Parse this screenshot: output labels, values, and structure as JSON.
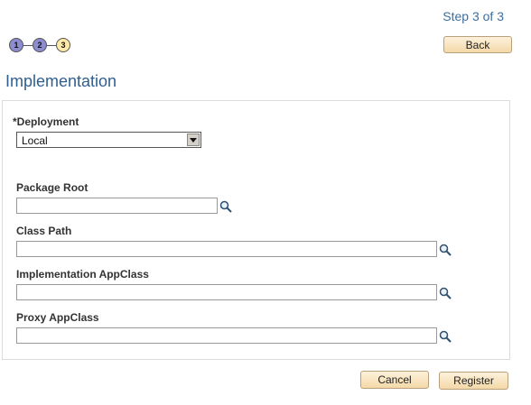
{
  "header": {
    "step_label": "Step 3 of 3",
    "steps": [
      {
        "number": "1",
        "state": "done"
      },
      {
        "number": "2",
        "state": "done"
      },
      {
        "number": "3",
        "state": "current"
      }
    ],
    "back_label": "Back"
  },
  "page_title": "Implementation",
  "form": {
    "deployment": {
      "label": "*Deployment",
      "value": "Local"
    },
    "package_root": {
      "label": "Package Root",
      "value": ""
    },
    "class_path": {
      "label": "Class Path",
      "value": ""
    },
    "implementation_appclass": {
      "label": "Implementation AppClass",
      "value": ""
    },
    "proxy_appclass": {
      "label": "Proxy AppClass",
      "value": ""
    }
  },
  "footer": {
    "cancel_label": "Cancel",
    "register_label": "Register"
  },
  "colors": {
    "accent": "#2f5f8f",
    "step_done": "#8c8ccf",
    "step_current": "#ffe9a8",
    "button_bg": "#f4d9a8"
  },
  "icons": {
    "lookup": "magnifier-icon"
  }
}
